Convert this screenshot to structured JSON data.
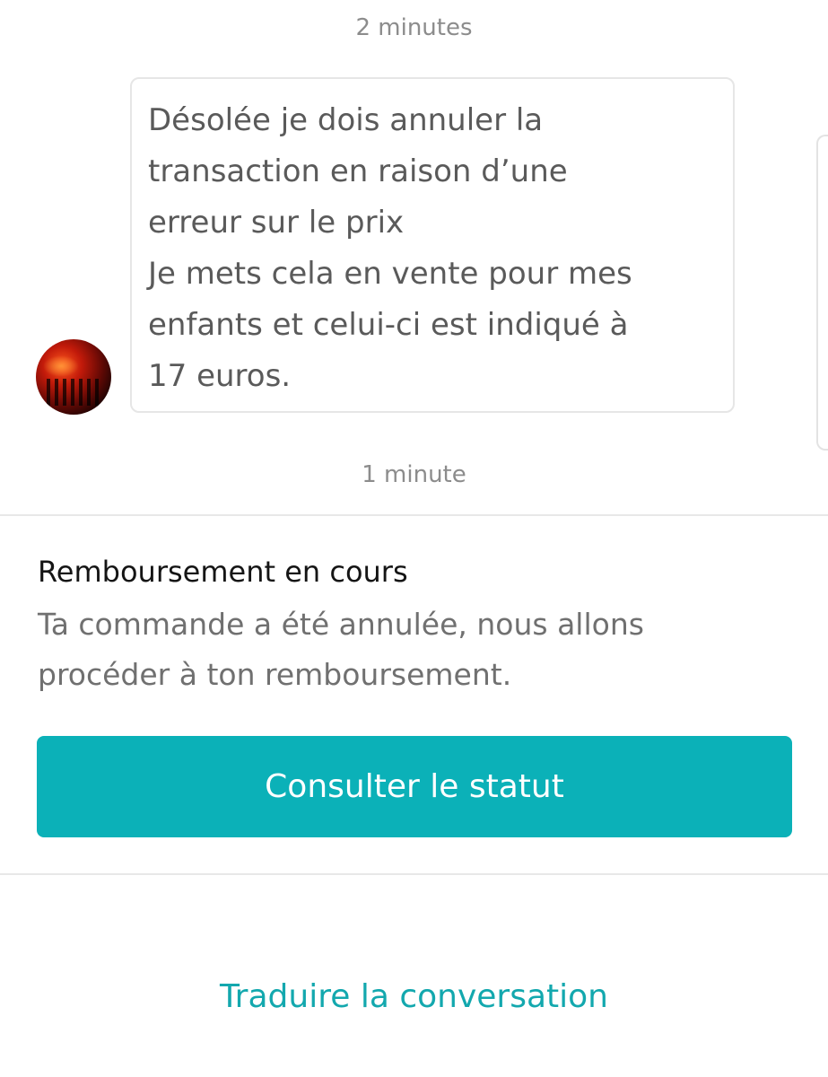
{
  "conversation": {
    "timestamps": [
      "2 minutes",
      "1 minute"
    ],
    "message": {
      "text": "Désolée je dois annuler la\ntransaction en raison d’une\nerreur sur le prix\nJe mets cela en vente pour mes\nenfants et celui-ci est indiqué à\n17 euros."
    }
  },
  "status": {
    "title": "Remboursement en cours",
    "description": "Ta commande a été annulée, nous allons procéder à ton remboursement.",
    "button_label": "Consulter le statut"
  },
  "footer": {
    "translate_label": "Traduire la conversation"
  },
  "colors": {
    "accent": "#0bb1b8",
    "link": "#13a8ae"
  }
}
